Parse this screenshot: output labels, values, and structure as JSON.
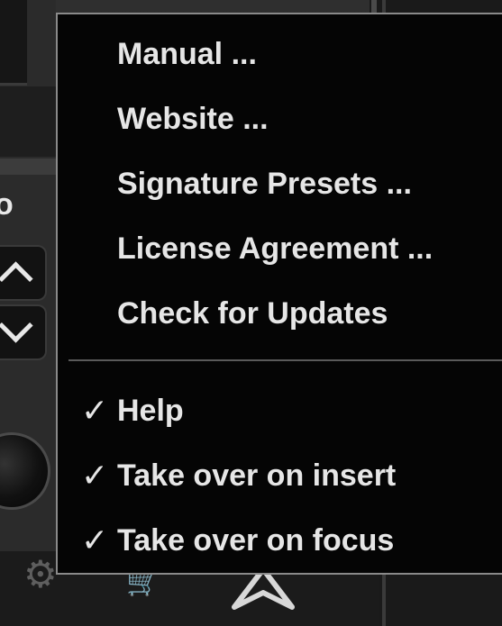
{
  "menu": {
    "items": [
      {
        "label": "Manual ..."
      },
      {
        "label": "Website ..."
      },
      {
        "label": "Signature Presets ..."
      },
      {
        "label": "License Agreement ..."
      },
      {
        "label": "Check for Updates"
      }
    ],
    "toggles": [
      {
        "label": "Help",
        "checked": true,
        "check_glyph": "✓"
      },
      {
        "label": "Take over on insert",
        "checked": true,
        "check_glyph": "✓"
      },
      {
        "label": "Take over on focus",
        "checked": true,
        "check_glyph": "✓"
      }
    ]
  },
  "background": {
    "partial_letter": "o",
    "icons": [
      "chevron-up-icon",
      "chevron-down-icon",
      "knob-icon",
      "gear-icon",
      "cart-icon",
      "logo-icon"
    ]
  },
  "colors": {
    "menu_background": "#050505",
    "menu_text": "#e6e6e6",
    "menu_border": "#8a8a8a"
  }
}
